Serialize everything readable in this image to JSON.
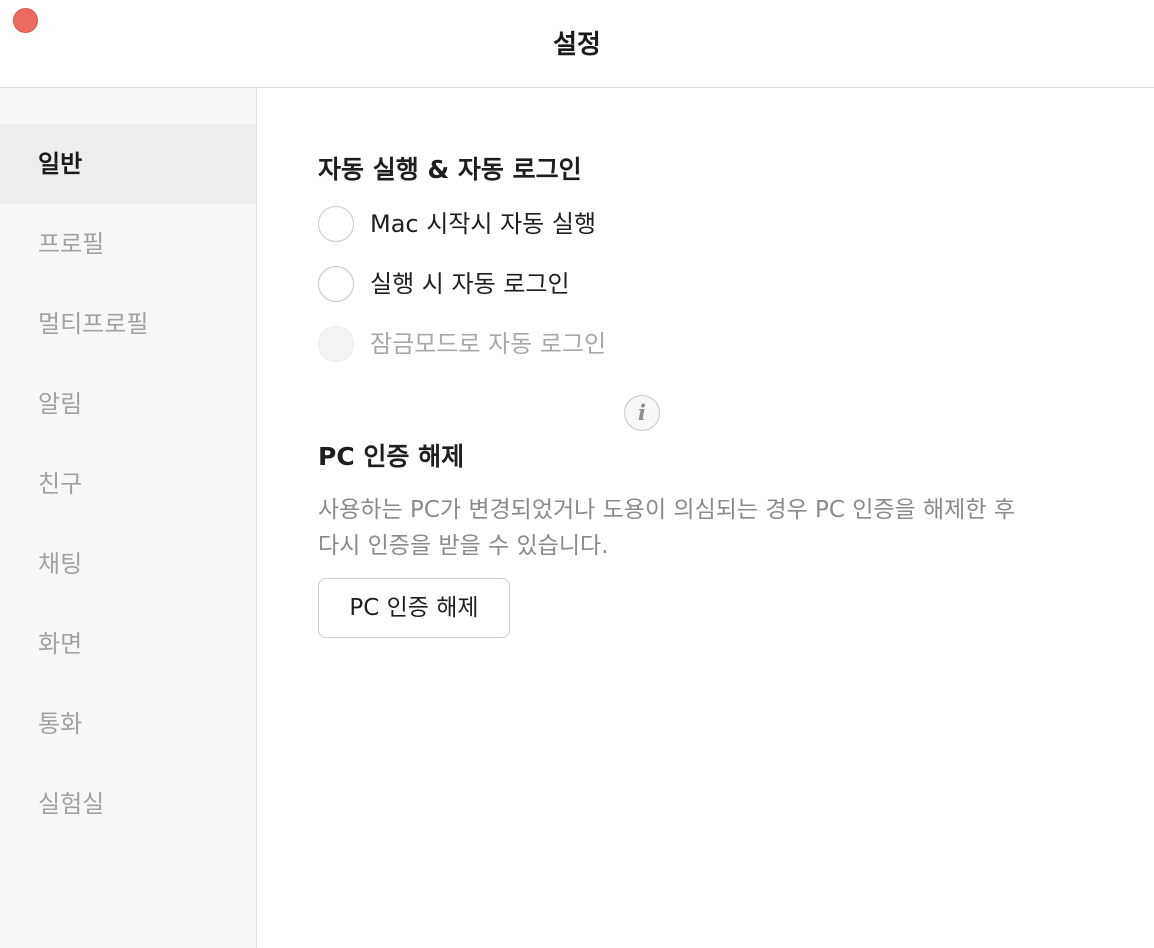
{
  "window": {
    "title": "설정"
  },
  "sidebar": {
    "items": [
      {
        "label": "일반",
        "active": true
      },
      {
        "label": "프로필",
        "active": false
      },
      {
        "label": "멀티프로필",
        "active": false
      },
      {
        "label": "알림",
        "active": false
      },
      {
        "label": "친구",
        "active": false
      },
      {
        "label": "채팅",
        "active": false
      },
      {
        "label": "화면",
        "active": false
      },
      {
        "label": "통화",
        "active": false
      },
      {
        "label": "실험실",
        "active": false
      }
    ]
  },
  "general": {
    "autostart_section": {
      "title": "자동 실행 & 자동 로그인",
      "options": [
        {
          "label": "Mac 시작시 자동 실행",
          "checked": false,
          "disabled": false
        },
        {
          "label": "실행 시 자동 로그인",
          "checked": false,
          "disabled": false
        },
        {
          "label": "잠금모드로 자동 로그인",
          "checked": false,
          "disabled": true
        }
      ],
      "info_icon": "info-icon",
      "info_glyph": "i"
    },
    "pc_auth_section": {
      "title": "PC 인증 해제",
      "description_lines": [
        "사용하는 PC가 변경되었거나 도용이 의심되는 경우 PC 인증을 해제한 후",
        "다시 인증을 받을 수 있습니다."
      ],
      "button_label": "PC 인증 해제"
    }
  },
  "colors": {
    "close_button": "#ed6a5e",
    "sidebar_bg": "#f7f7f7",
    "sidebar_active_bg": "#ededed",
    "disabled_text": "#a8a8a8"
  }
}
